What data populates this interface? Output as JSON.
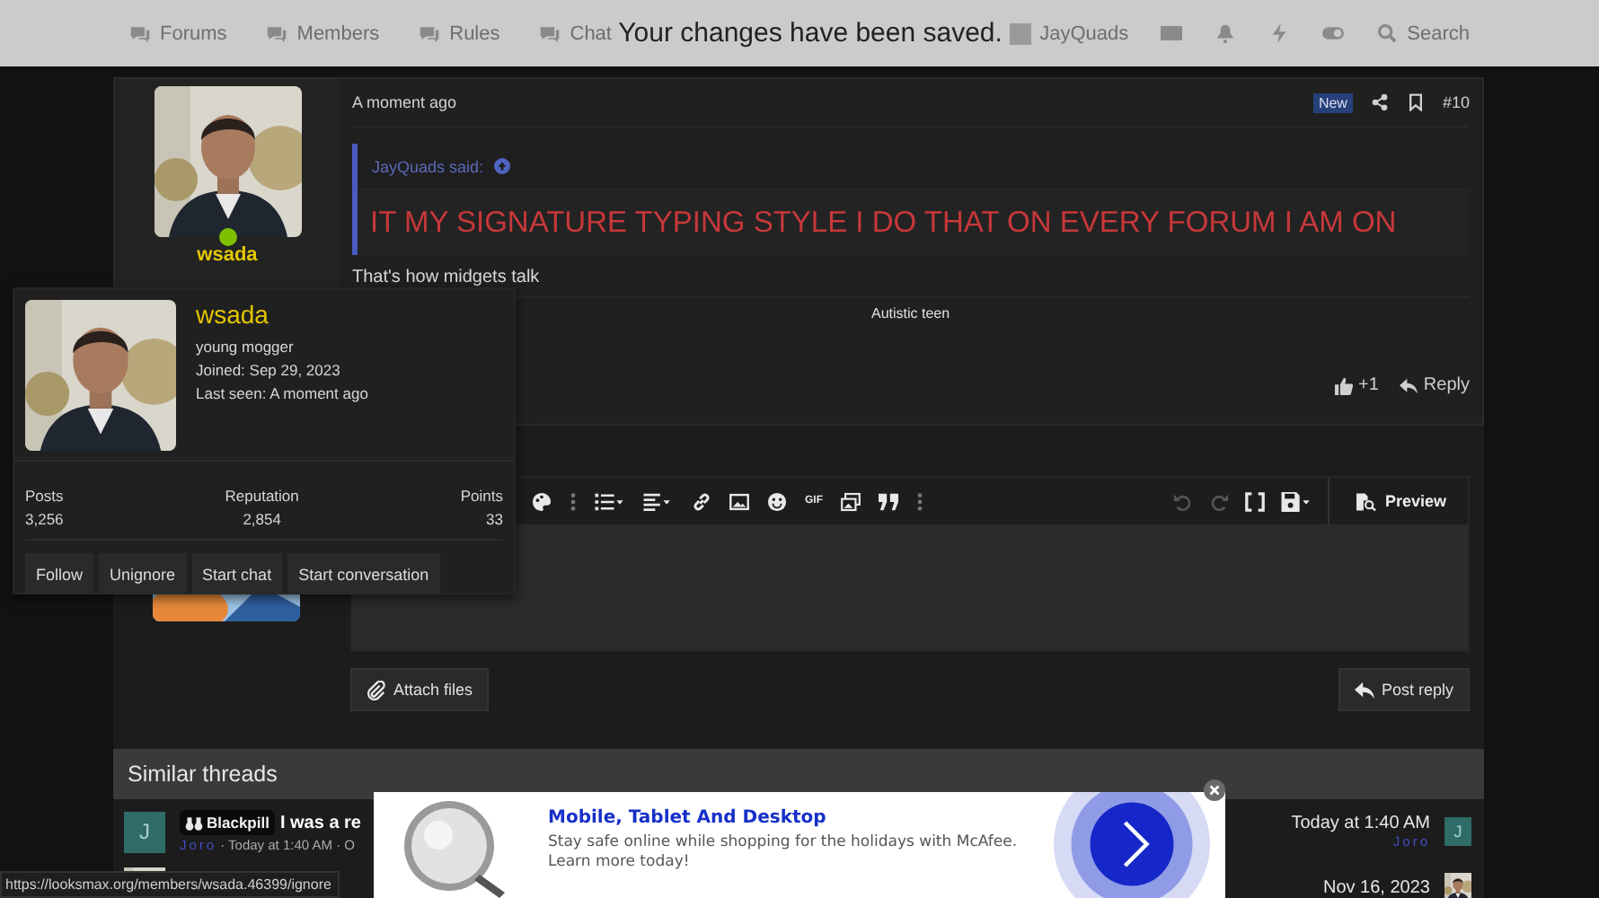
{
  "nav": {
    "items": [
      "Forums",
      "Members",
      "Rules",
      "Chat"
    ],
    "toast": "Your changes have been saved.",
    "user": "JayQuads",
    "search": "Search"
  },
  "post": {
    "time": "A moment ago",
    "badge": "New",
    "number": "#10",
    "author": {
      "name": "wsada",
      "online": true
    },
    "quote": {
      "author": "JayQuads said:",
      "text": "IT MY SIGNATURE TYPING STYLE I DO THAT ON EVERY FORUM I AM ON"
    },
    "body": "That's how midgets talk",
    "signature": "Autistic teen",
    "likes": "+1",
    "reply": "Reply"
  },
  "profile_card": {
    "name": "wsada",
    "title": "young mogger",
    "joined": "Joined: Sep 29, 2023",
    "last_seen": "Last seen: A moment ago",
    "stats": [
      {
        "label": "Posts",
        "value": "3,256"
      },
      {
        "label": "Reputation",
        "value": "2,854"
      },
      {
        "label": "Points",
        "value": "33"
      }
    ],
    "buttons": [
      "Follow",
      "Unignore",
      "Start chat",
      "Start conversation"
    ]
  },
  "editor": {
    "gif": "GIF",
    "undo": {
      "disabled": true
    },
    "redo": {
      "disabled": true
    },
    "preview": "Preview",
    "attach": "Attach files",
    "post_reply": "Post reply"
  },
  "similar_threads": {
    "title": "Similar threads",
    "threads": [
      {
        "kind": "letter",
        "avatar": "J",
        "tag": "Blackpill",
        "title": "I was a re",
        "author": "Joro",
        "meta": "· Today at 1:40 AM · O",
        "last_date": "Today at 1:40 AM",
        "last_user": "Joro",
        "last_avatar": "J"
      },
      {
        "kind": "picture",
        "last_date": "Nov 16, 2023"
      }
    ]
  },
  "ad": {
    "title": "Mobile, Tablet And Desktop",
    "text": "Stay safe online while shopping for the holidays with McAfee. Learn more today!"
  },
  "status_url": "https://looksmax.org/members/wsada.46399/ignore"
}
